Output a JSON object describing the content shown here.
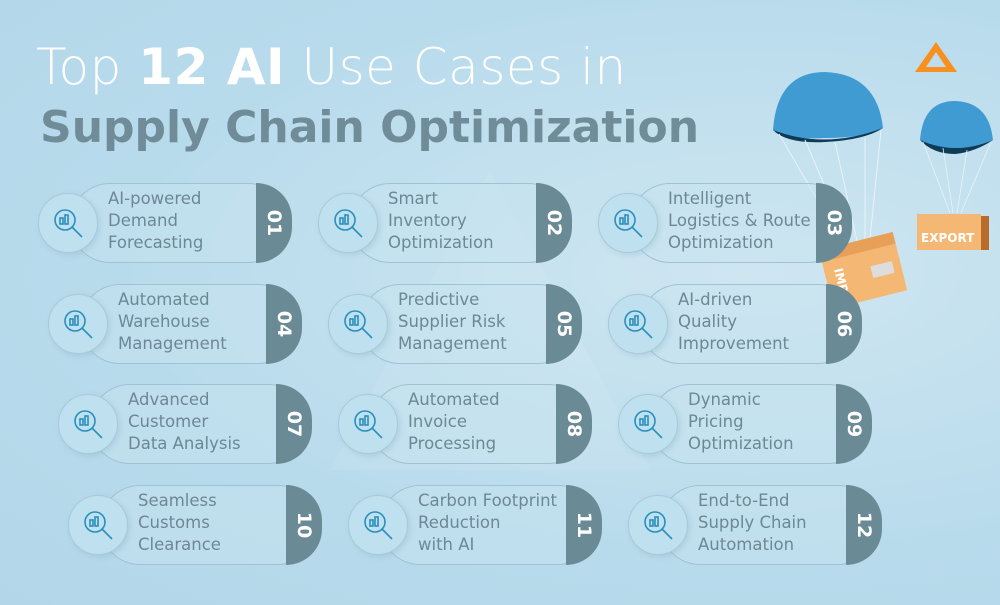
{
  "title": {
    "prefix": "Top ",
    "bold": "12 AI",
    "suffix": " Use Cases in",
    "line2": "Supply Chain Optimization"
  },
  "colors": {
    "background": "#b9dcec",
    "badge": "#6a8a96",
    "text": "#6d8894",
    "accent": "#f7901e",
    "icon": "#2b8fbd"
  },
  "boxes": {
    "import": "IMPORT",
    "export": "EXPORT"
  },
  "cases": [
    {
      "num": "01",
      "label": "AI-powered\nDemand\nForecasting",
      "icon": "magnifier-chart-icon"
    },
    {
      "num": "02",
      "label": "Smart\nInventory\nOptimization",
      "icon": "boxes-phone-icon"
    },
    {
      "num": "03",
      "label": "Intelligent\nLogistics & Route\nOptimization",
      "icon": "hand-truck-icon"
    },
    {
      "num": "04",
      "label": "Automated\nWarehouse\nManagement",
      "icon": "warehouse-icon"
    },
    {
      "num": "05",
      "label": "Predictive\nSupplier Risk\nManagement",
      "icon": "checklist-warning-icon"
    },
    {
      "num": "06",
      "label": "AI-driven\nQuality\nImprovement",
      "icon": "ai-brain-icon"
    },
    {
      "num": "07",
      "label": "Advanced\nCustomer\nData Analysis",
      "icon": "analysis-icon"
    },
    {
      "num": "08",
      "label": "Automated\nInvoice\nProcessing",
      "icon": "invoice-dollar-icon"
    },
    {
      "num": "09",
      "label": "Dynamic\nPricing\nOptimization",
      "icon": "price-tags-icon"
    },
    {
      "num": "10",
      "label": "Seamless\nCustoms\nClearance",
      "icon": "clipboard-box-icon"
    },
    {
      "num": "11",
      "label": "Carbon Footprint\nReduction\nwith AI",
      "icon": "cloud-arrows-icon"
    },
    {
      "num": "12",
      "label": "End-to-End\nSupply Chain\nAutomation",
      "icon": "network-cube-icon"
    }
  ]
}
